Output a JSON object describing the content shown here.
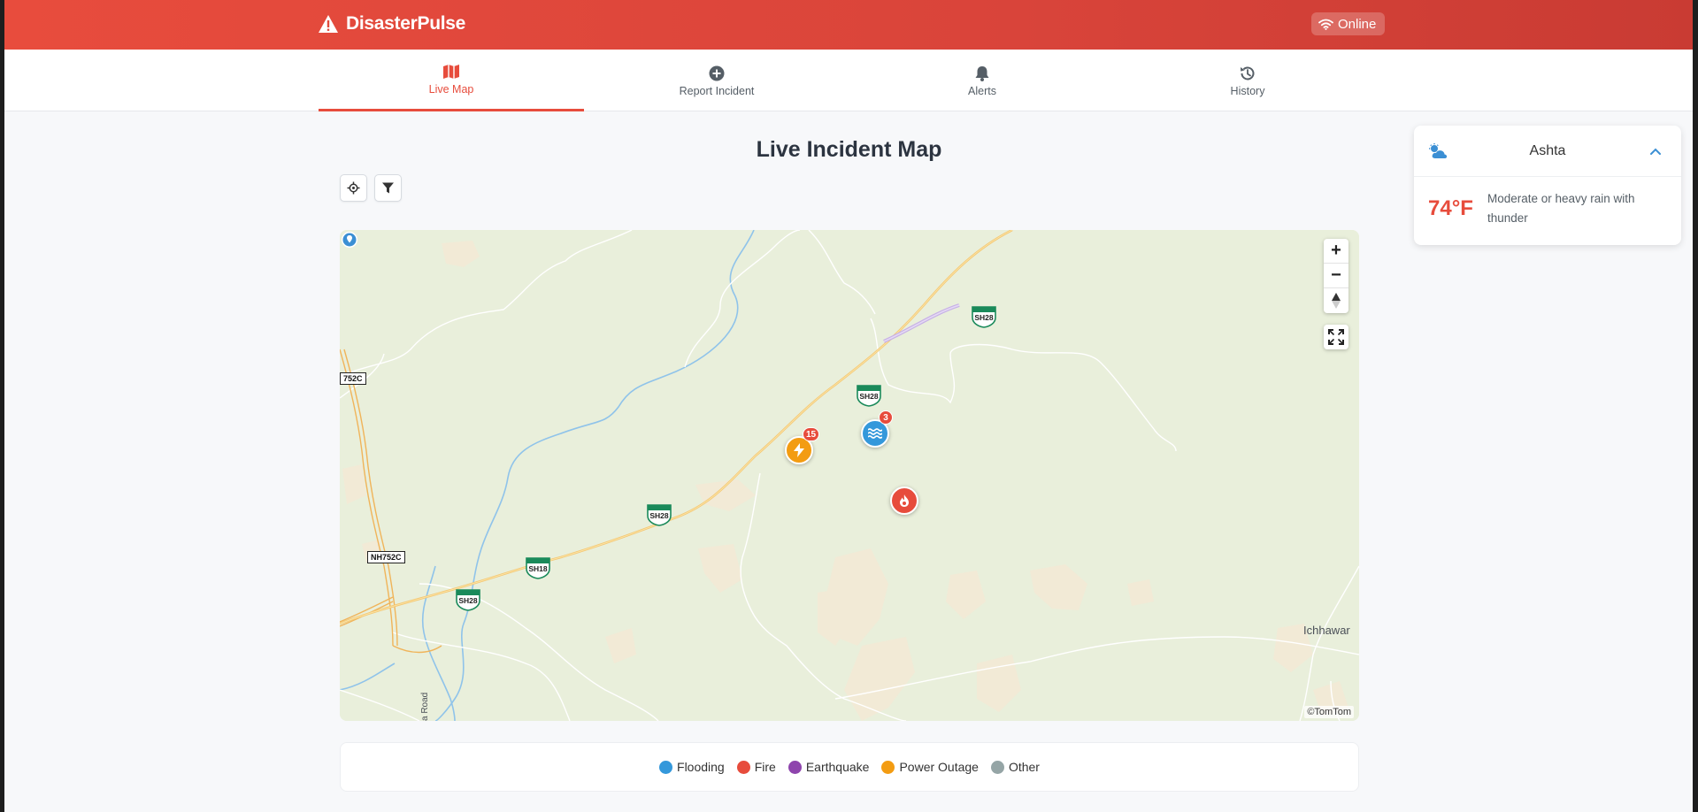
{
  "app": {
    "title": "DisasterPulse",
    "status": "Online"
  },
  "nav": {
    "tabs": [
      {
        "label": "Live Map",
        "icon": "map-icon",
        "active": true
      },
      {
        "label": "Report Incident",
        "icon": "plus-circle-icon",
        "active": false
      },
      {
        "label": "Alerts",
        "icon": "bell-icon",
        "active": false
      },
      {
        "label": "History",
        "icon": "history-icon",
        "active": false
      }
    ]
  },
  "main": {
    "title": "Live Incident Map"
  },
  "map": {
    "attribution": "©TomTom",
    "road_labels": [
      "752C",
      "NH752C",
      "SH28",
      "SH28",
      "SH28",
      "SH28",
      "SH18"
    ],
    "place_labels": [
      "Ichhawar"
    ],
    "road_name": "a Road",
    "markers": [
      {
        "type": "Power Outage",
        "count": "15",
        "color": "#f39c12"
      },
      {
        "type": "Flooding",
        "count": "3",
        "color": "#3498db"
      },
      {
        "type": "Fire",
        "count": "",
        "color": "#e74c3c"
      }
    ],
    "zoom_in": "+",
    "zoom_out": "−"
  },
  "legend": [
    {
      "label": "Flooding",
      "color": "#3498db"
    },
    {
      "label": "Fire",
      "color": "#e74c3c"
    },
    {
      "label": "Earthquake",
      "color": "#8e44ad"
    },
    {
      "label": "Power Outage",
      "color": "#f39c12"
    },
    {
      "label": "Other",
      "color": "#95a5a6"
    }
  ],
  "weather": {
    "city": "Ashta",
    "temperature": "74°F",
    "description": "Moderate or heavy rain with thunder",
    "icon": "cloud-sun-icon"
  },
  "colors": {
    "accent": "#e74c3c",
    "header_start": "#e84c3d",
    "header_end": "#c93b33"
  }
}
